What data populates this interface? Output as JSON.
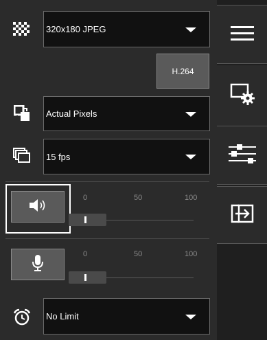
{
  "video": {
    "resolution": "320x180 JPEG",
    "codec_button": "H.264",
    "scale": "Actual Pixels",
    "framerate": "15 fps"
  },
  "speaker": {
    "ticks": [
      "0",
      "50",
      "100"
    ],
    "level": 0.14
  },
  "microphone": {
    "ticks": [
      "0",
      "50",
      "100"
    ],
    "level": 0.14
  },
  "timer": {
    "value": "No Limit"
  },
  "icons": {
    "resolution": "checkerboard-icon",
    "scale": "scale-icon",
    "framerate": "frames-icon",
    "speaker": "speaker-icon",
    "microphone": "microphone-icon",
    "timer": "alarm-clock-icon",
    "tabs": [
      "menu-icon",
      "screen-settings-icon",
      "sliders-icon",
      "exit-icon"
    ]
  },
  "colors": {
    "panel": "#2b2b2b",
    "sidebar": "#1f1f1f",
    "button": "#5a5a5a"
  }
}
